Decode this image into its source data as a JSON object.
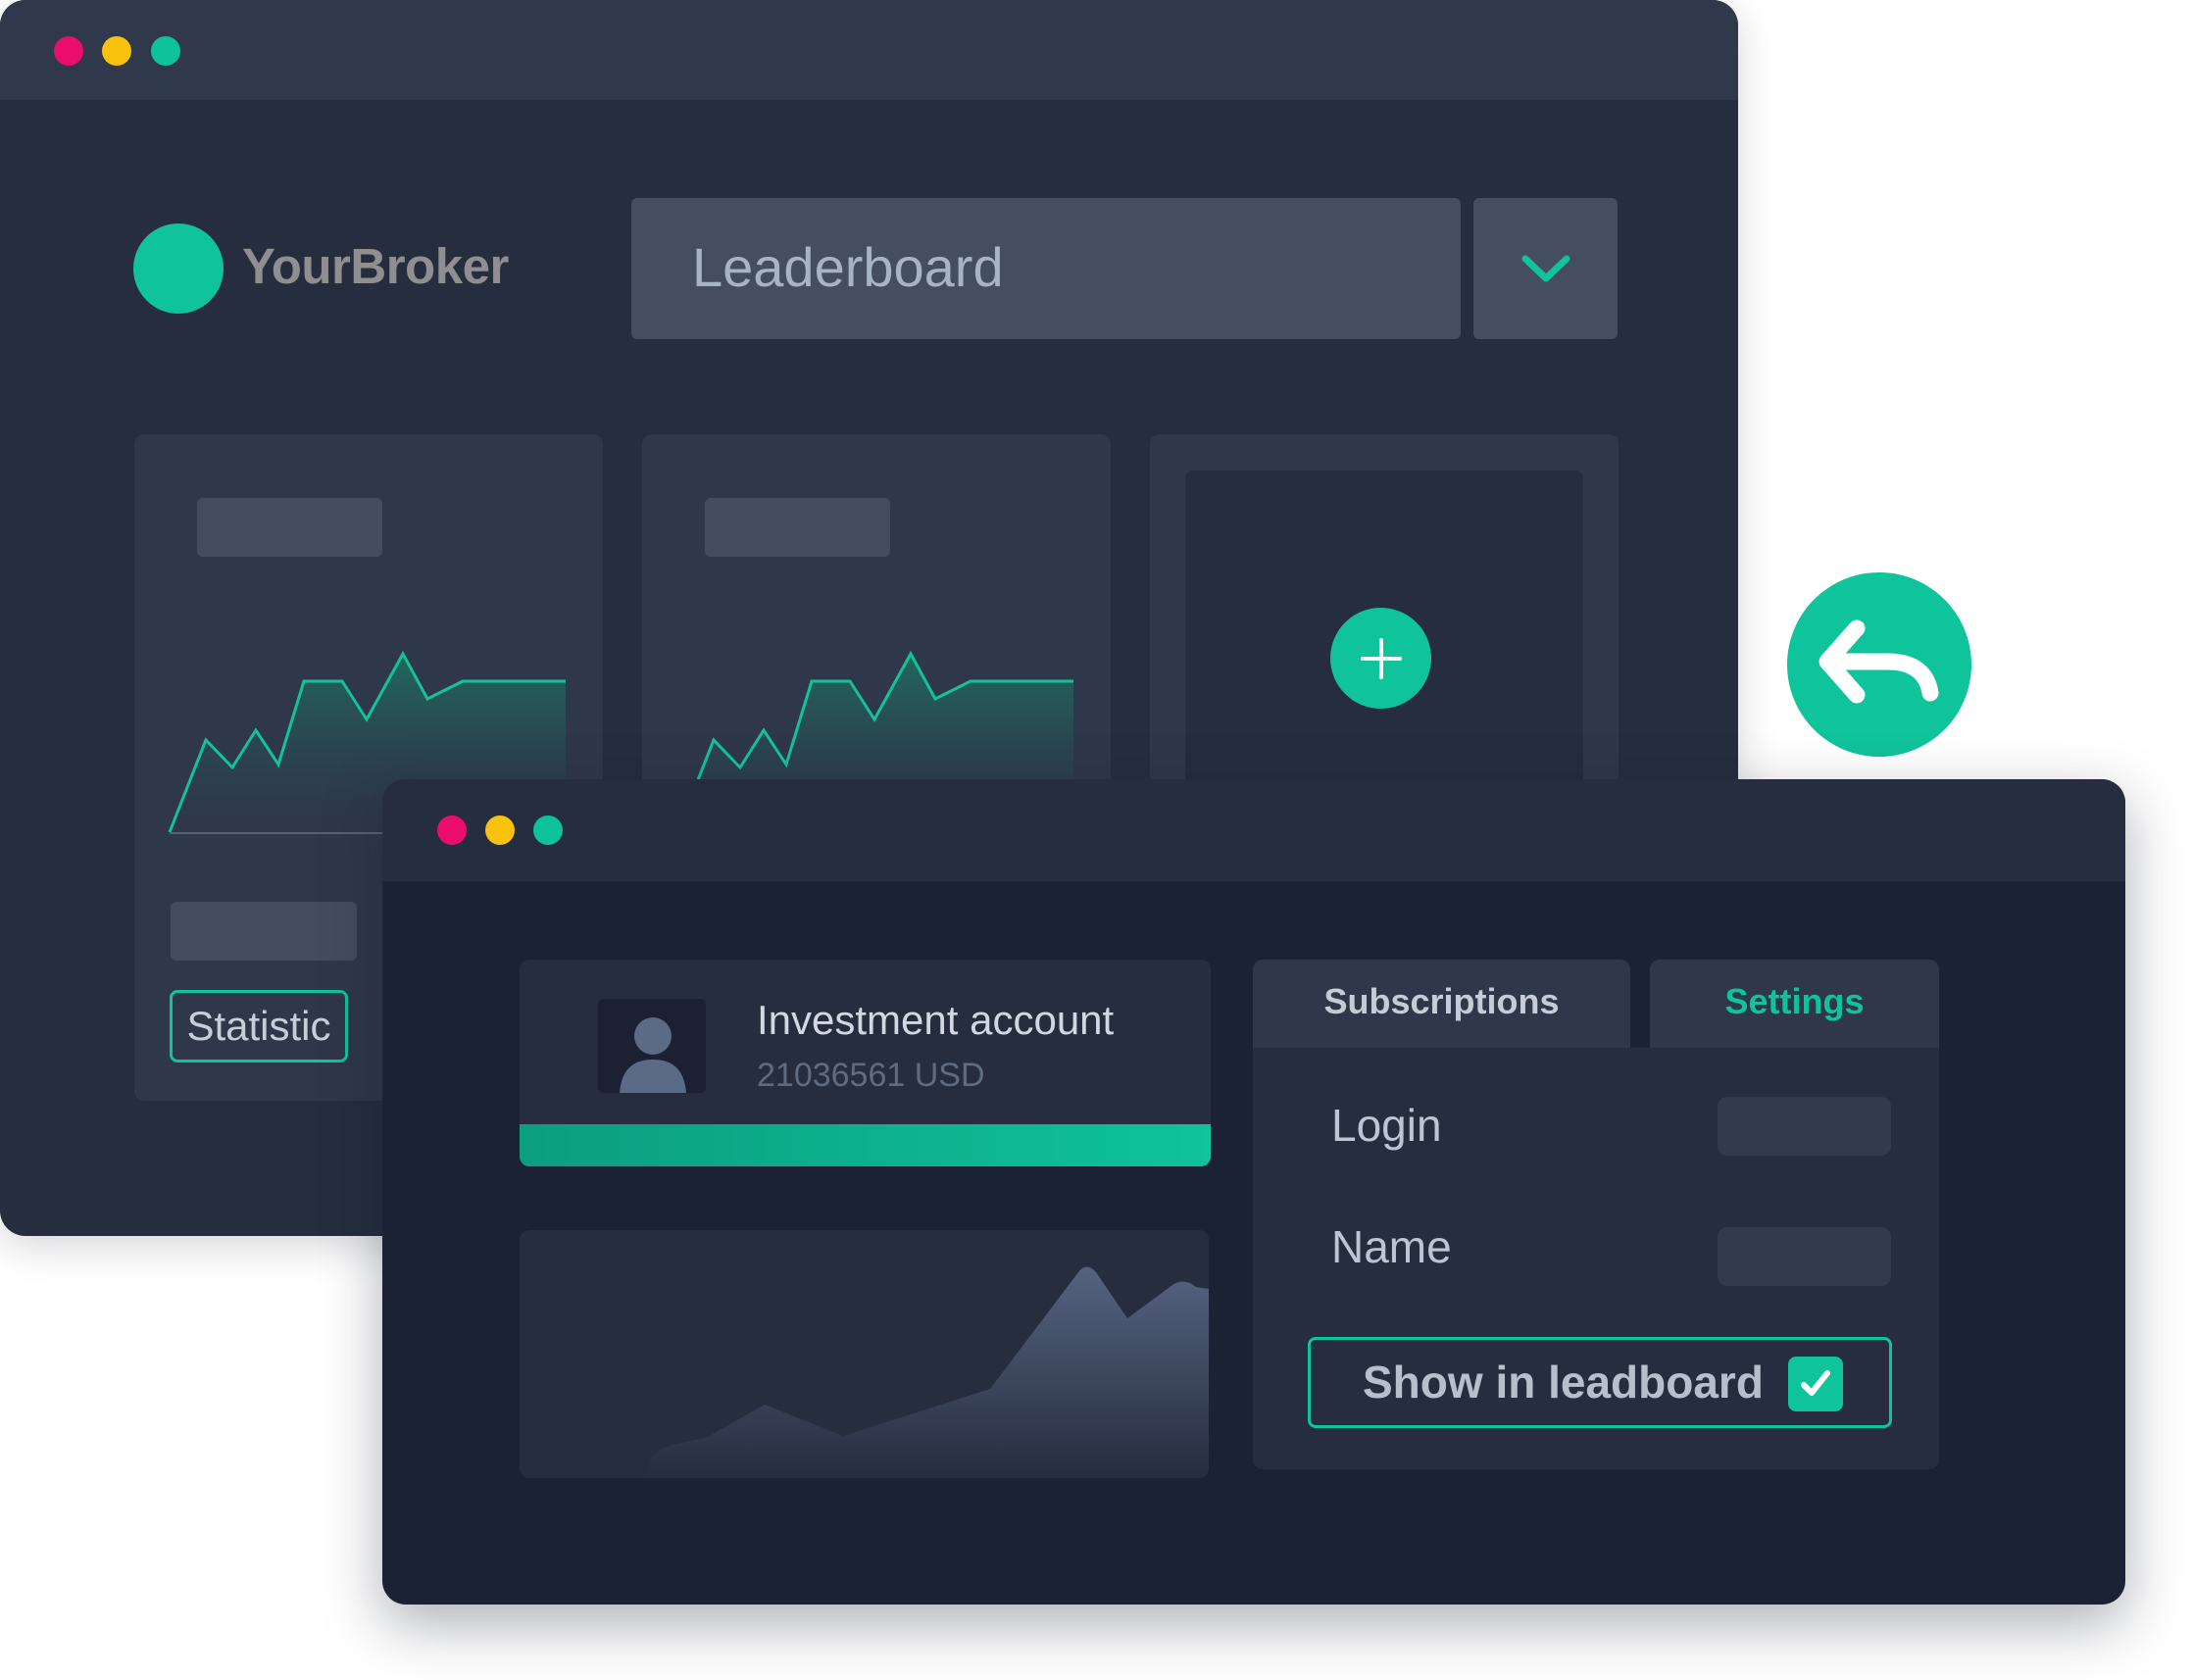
{
  "colors": {
    "accent": "#0fc39a",
    "window_dark": "#252d3f",
    "window_darker": "#1b2234",
    "dot_red": "#ea0d6d",
    "dot_yellow": "#f8c20d",
    "dot_green": "#0dc39a"
  },
  "back_window": {
    "brand": {
      "name": "YourBroker"
    },
    "view_select": {
      "value": "Leaderboard",
      "icon": "chevron-down-icon"
    },
    "cards": [
      {
        "action": "Statistic"
      },
      {},
      {
        "icon": "plus-icon"
      }
    ]
  },
  "back_arrow": {
    "icon": "reply-arrow-icon"
  },
  "front_window": {
    "account": {
      "title": "Investment account",
      "number": "21036561 USD",
      "icon": "user-icon"
    },
    "tabs": [
      {
        "label": "Subscriptions",
        "active": false
      },
      {
        "label": "Settings",
        "active": true
      }
    ],
    "settings": {
      "login_label": "Login",
      "name_label": "Name",
      "show_in_leaderboard_label": "Show in leadboard",
      "show_in_leaderboard_checked": true
    }
  }
}
